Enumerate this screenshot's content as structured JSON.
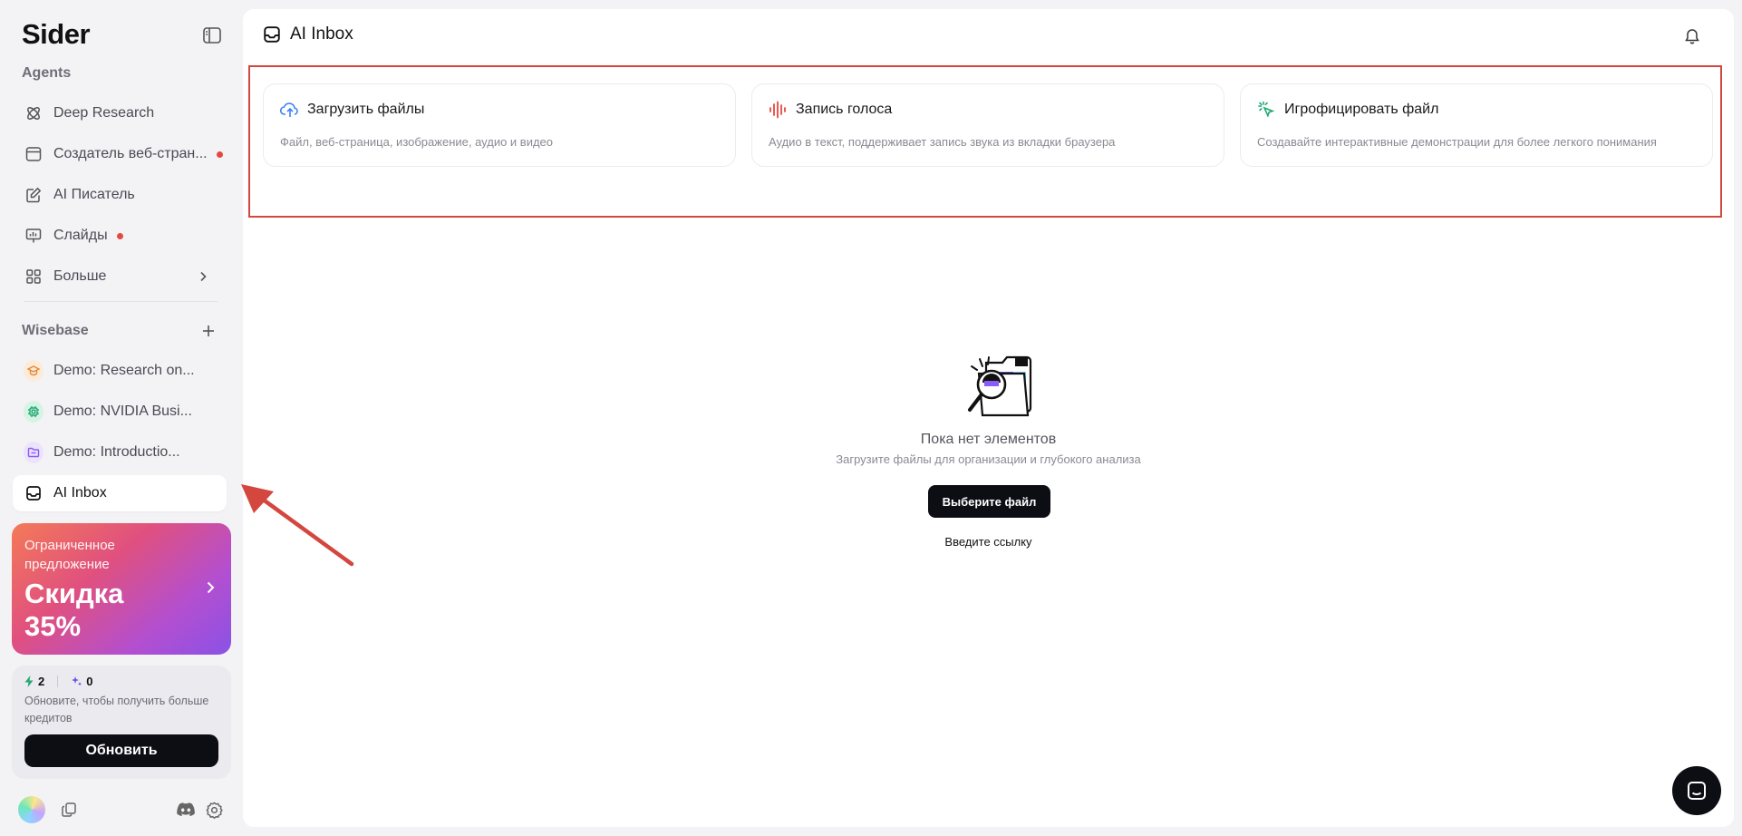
{
  "app": {
    "logo": "Sider"
  },
  "sidebar": {
    "agents_label": "Agents",
    "agents": [
      {
        "label": "Deep Research",
        "icon": "deep-research-icon",
        "dot": false
      },
      {
        "label": "Создатель веб-стран...",
        "icon": "web-creator-icon",
        "dot": true
      },
      {
        "label": "AI Писатель",
        "icon": "writer-icon",
        "dot": false
      },
      {
        "label": "Слайды",
        "icon": "slides-icon",
        "dot": true
      },
      {
        "label": "Больше",
        "icon": "grid-icon",
        "dot": false
      }
    ],
    "wisebase_label": "Wisebase",
    "wisebase": [
      {
        "label": "Demo: Research on...",
        "icon": "graduation-cap-icon",
        "color": "#e8862f"
      },
      {
        "label": "Demo: NVIDIA Busi...",
        "icon": "chip-icon",
        "color": "#1fa971"
      },
      {
        "label": "Demo: Introductio...",
        "icon": "folder-icon",
        "color": "#8b5cf6"
      },
      {
        "label": "AI Inbox",
        "icon": "inbox-icon",
        "color": "#111111"
      }
    ],
    "promo": {
      "small": "Ограниченное предложение",
      "big": "Скидка 35%"
    },
    "credits": {
      "fast": "2",
      "advanced": "0",
      "desc": "Обновите, чтобы получить больше кредитов",
      "button": "Обновить"
    }
  },
  "main": {
    "title": "AI Inbox",
    "cards": [
      {
        "title": "Загрузить файлы",
        "sub": "Файл, веб-страница, изображение, аудио и видео",
        "icon": "cloud-upload-icon"
      },
      {
        "title": "Запись голоса",
        "sub": "Аудио в текст, поддерживает запись звука из вкладки браузера",
        "icon": "voice-wave-icon"
      },
      {
        "title": "Игрофицировать файл",
        "sub": "Создавайте интерактивные демонстрации для более легкого понимания",
        "icon": "sparkle-click-icon"
      }
    ],
    "empty": {
      "title": "Пока нет элементов",
      "sub": "Загрузите файлы для организации и глубокого анализа",
      "button": "Выберите файл",
      "link": "Введите ссылку"
    }
  },
  "colors": {
    "accent_red": "#d4473f",
    "dark": "#0d0d14",
    "dot_red": "#e5483e"
  }
}
